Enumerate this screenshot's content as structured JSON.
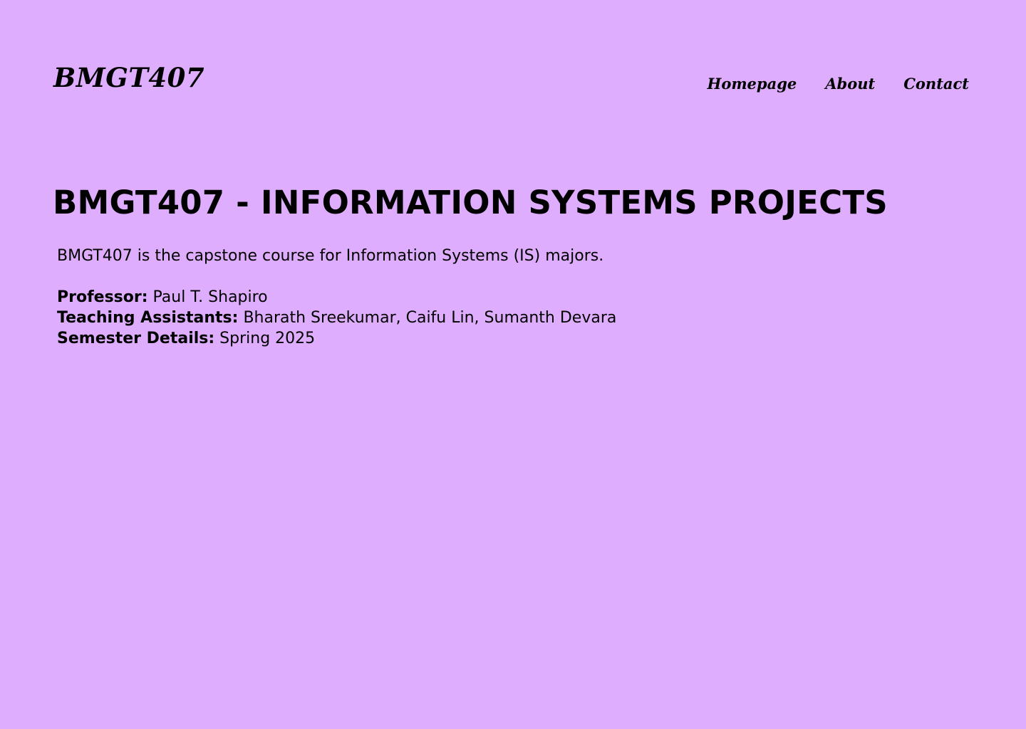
{
  "header": {
    "logo": "BMGT407",
    "nav": [
      {
        "label": "Homepage"
      },
      {
        "label": "About"
      },
      {
        "label": "Contact"
      }
    ]
  },
  "main": {
    "title": "BMGT407 - INFORMATION SYSTEMS PROJECTS",
    "intro": "BMGT407 is the capstone course for Information Systems (IS) majors.",
    "details": [
      {
        "label": "Professor:",
        "value": "Paul T. Shapiro"
      },
      {
        "label": "Teaching Assistants:",
        "value": "Bharath Sreekumar, Caifu Lin, Sumanth Devara"
      },
      {
        "label": "Semester Details:",
        "value": "Spring 2025"
      }
    ]
  },
  "colors": {
    "background": "#dfadfd",
    "text": "#000000"
  }
}
